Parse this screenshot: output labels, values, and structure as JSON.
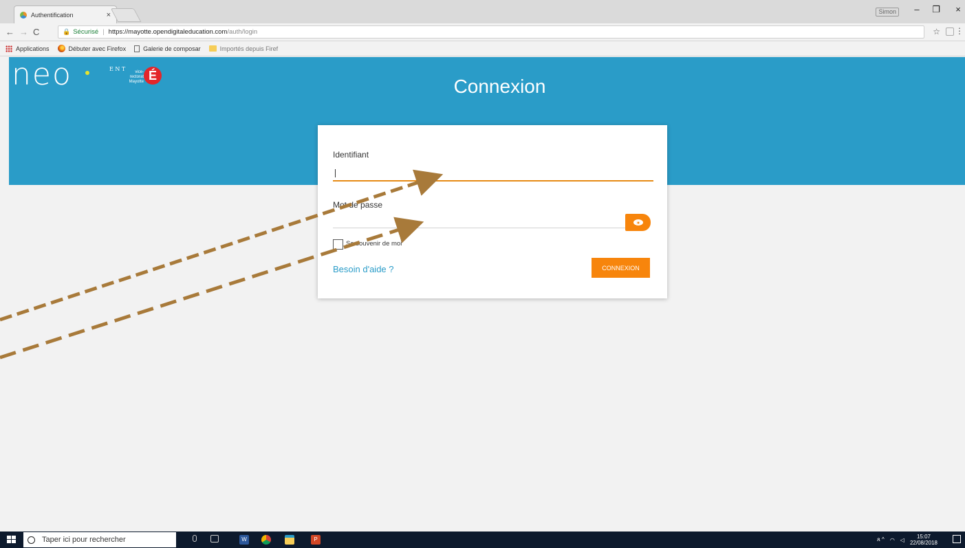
{
  "browser": {
    "tab_title": "Authentification",
    "tab_close": "×",
    "window_user": "Simon",
    "window_controls": {
      "minimize": "–",
      "restore": "❐",
      "close": "×"
    },
    "nav": {
      "back": "←",
      "forward": "→",
      "reload": "C"
    },
    "secure_label": "Sécurisé",
    "url_host": "https://mayotte.opendigitaleducation.com",
    "url_path": "/auth/login",
    "bookmark_star": "☆",
    "menu": "⋮",
    "bookmarks": [
      "Applications",
      "Débuter avec Firefox",
      "Galerie de composar",
      "Importés depuis Firef"
    ]
  },
  "page": {
    "logo": {
      "text": "neo",
      "ent_letters": "E N T",
      "vice_rectorat": "vice-rectorat Mayotte",
      "e_letter": "É"
    },
    "title": "Connexion",
    "form": {
      "identifiant_label": "Identifiant",
      "identifiant_value": "",
      "password_label": "Mot de passe",
      "password_value": "",
      "remember_label": "Se souvenir de moi",
      "help_link": "Besoin d'aide ?",
      "submit_label": "CONNEXION"
    },
    "colors": {
      "header": "#2a9cc8",
      "accent": "#f7850c",
      "link": "#2a9cc8",
      "arrow": "#a87a3a"
    }
  },
  "taskbar": {
    "search_placeholder": "Taper ici pour rechercher",
    "word_label": "W",
    "ppt_label": "P",
    "tray_icons": "ጸ  ^",
    "time": "15:07",
    "date": "22/08/2018"
  }
}
